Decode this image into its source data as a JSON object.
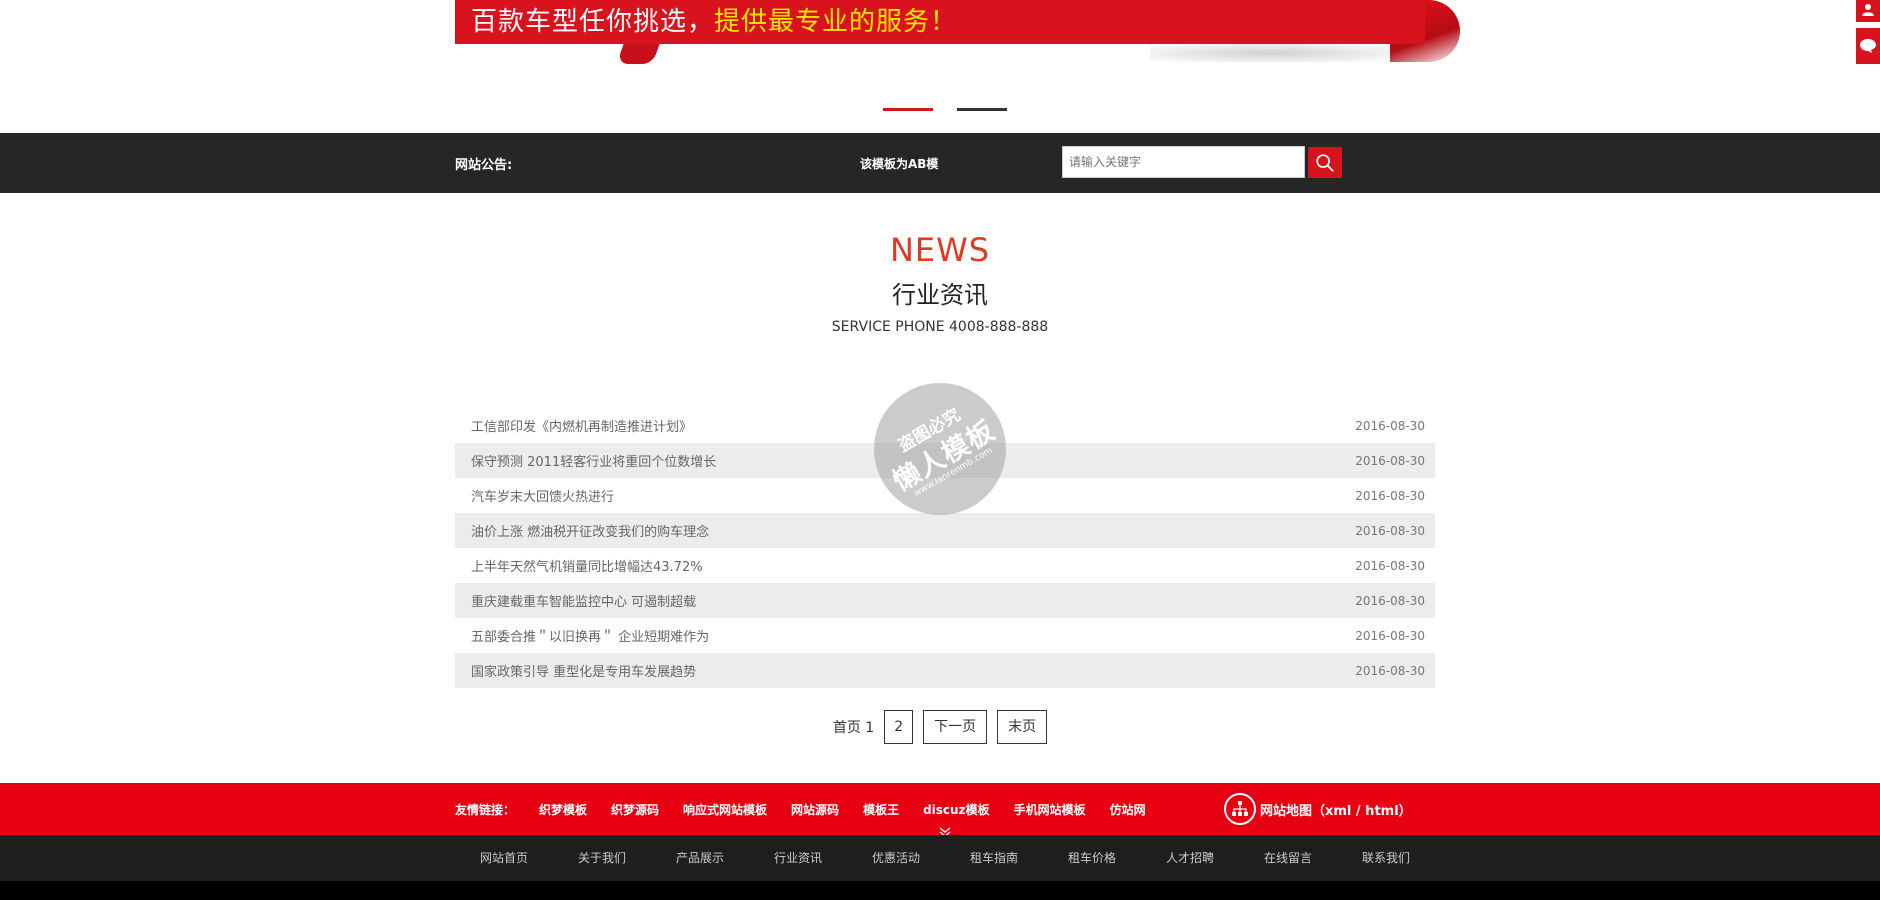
{
  "banner": {
    "text_white": "百款车型任你挑选，",
    "text_yellow": "提供最专业的服务！",
    "slides": [
      {
        "active": true
      },
      {
        "active": false
      }
    ]
  },
  "notice": {
    "title": "网站公告:",
    "text": "该模板为AB模",
    "search_placeholder": "请输入关键字"
  },
  "heading": {
    "en": "NEWS",
    "cn": "行业资讯",
    "phone": "SERVICE PHONE 4008-888-888"
  },
  "news": [
    {
      "title": "工信部印发《内燃机再制造推进计划》",
      "date": "2016-08-30"
    },
    {
      "title": "保守预测 2011轻客行业将重回个位数增长",
      "date": "2016-08-30"
    },
    {
      "title": "汽车岁末大回馈火热进行",
      "date": "2016-08-30"
    },
    {
      "title": "油价上涨 燃油税开征改变我们的购车理念",
      "date": "2016-08-30"
    },
    {
      "title": "上半年天然气机销量同比增幅达43.72%",
      "date": "2016-08-30"
    },
    {
      "title": "重庆建载重车智能监控中心 可遏制超载",
      "date": "2016-08-30"
    },
    {
      "title": "五部委合推＂以旧换再＂ 企业短期难作为",
      "date": "2016-08-30"
    },
    {
      "title": "国家政策引导 重型化是专用车发展趋势",
      "date": "2016-08-30"
    }
  ],
  "watermark": {
    "line1": "盗图必究",
    "line2": "懒人模板",
    "line3": "www.lanrenmb.com"
  },
  "pager": {
    "first": "首页",
    "current": "1",
    "page2": "2",
    "next": "下一页",
    "last": "末页"
  },
  "links": {
    "label": "友情链接：",
    "items": [
      "织梦模板",
      "织梦源码",
      "响应式网站模板",
      "网站源码",
      "模板王",
      "discuz模板",
      "手机网站模板",
      "仿站网"
    ],
    "sitemap": "网站地图（xml / html）"
  },
  "footer_nav": [
    "网站首页",
    "关于我们",
    "产品展示",
    "行业资讯",
    "优惠活动",
    "租车指南",
    "租车价格",
    "人才招聘",
    "在线留言",
    "联系我们"
  ],
  "colors": {
    "brand_red": "#e60012",
    "dark_bar": "#262626",
    "accent_text": "#e03a22"
  },
  "icons": {
    "search": "search-icon",
    "sitemap": "sitemap-icon",
    "toggle": "chevron-down-icon",
    "side_tool_1": "user-icon",
    "side_tool_2": "chat-icon"
  }
}
